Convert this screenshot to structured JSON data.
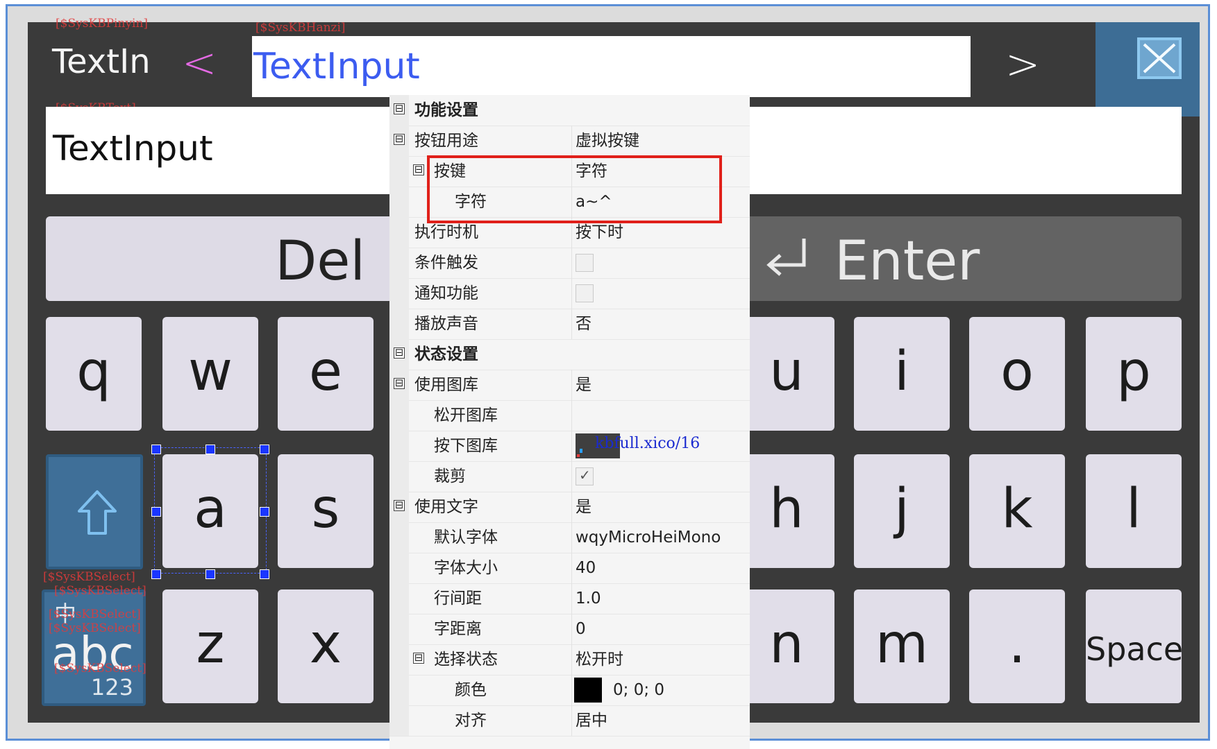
{
  "keyboard": {
    "title": "TextIn",
    "nav_prev": "<",
    "nav_next": ">",
    "candidate_input": "TextInput",
    "text_value": "TextInput",
    "del_label": "Del",
    "enter_label": "Enter",
    "keys_row1": [
      "q",
      "w",
      "e",
      "u",
      "i",
      "o",
      "p"
    ],
    "keys_row2": [
      "a",
      "s",
      "h",
      "j",
      "k",
      "l"
    ],
    "keys_row3": [
      "z",
      "x",
      "n",
      "m",
      ".",
      "Space"
    ],
    "lang_zh": "中",
    "lang_abc": "abc",
    "lang_num": "123",
    "tags": {
      "pinyin": "[$SysKBPinyin]",
      "hanzi": "[$SysKBHanzi]",
      "text": "[$SysKBText]",
      "select1": "[$SysKBSelect]",
      "select2": "[$SysKBSelect]",
      "select3": "[$SysKBSelect]",
      "select4": "[$SysKBSelect]",
      "select5": "[$SysKBSelect]"
    }
  },
  "properties": {
    "rows": [
      {
        "name": "功能设置",
        "value": ""
      },
      {
        "name": "按钮用途",
        "value": "虚拟按键"
      },
      {
        "name": "按键",
        "value": "字符"
      },
      {
        "name": "字符",
        "value": "a~^"
      },
      {
        "name": "执行时机",
        "value": "按下时"
      },
      {
        "name": "条件触发",
        "value": ""
      },
      {
        "name": "通知功能",
        "value": ""
      },
      {
        "name": "播放声音",
        "value": "否"
      },
      {
        "name": "状态设置",
        "value": ""
      },
      {
        "name": "使用图库",
        "value": "是"
      },
      {
        "name": "松开图库",
        "value": ""
      },
      {
        "name": "按下图库",
        "value": "kbfull.xico/16"
      },
      {
        "name": "裁剪",
        "value": ""
      },
      {
        "name": "使用文字",
        "value": "是"
      },
      {
        "name": "默认字体",
        "value": "wqyMicroHeiMono"
      },
      {
        "name": "字体大小",
        "value": "40"
      },
      {
        "name": "行间距",
        "value": "1.0"
      },
      {
        "name": "字距离",
        "value": "0"
      },
      {
        "name": "选择状态",
        "value": "松开时"
      },
      {
        "name": "颜色",
        "value": "0; 0; 0"
      },
      {
        "name": "对齐",
        "value": "居中"
      }
    ],
    "collapse_symbol": "⊟",
    "checkbox_states": {
      "条件触发": false,
      "通知功能": false,
      "裁剪": true
    },
    "swatch_color": "#000000",
    "highlight_color": "#e0201a"
  }
}
